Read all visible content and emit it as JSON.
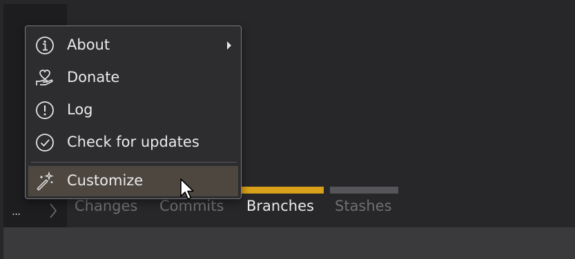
{
  "menu": {
    "items": [
      {
        "label": "About",
        "icon": "info-icon",
        "has_submenu": true
      },
      {
        "label": "Donate",
        "icon": "donate-heart-hand-icon"
      },
      {
        "label": "Log",
        "icon": "alert-circle-icon"
      },
      {
        "label": "Check for updates",
        "icon": "check-circle-icon"
      },
      {
        "label": "Customize",
        "icon": "magic-wand-icon",
        "highlighted": true
      }
    ]
  },
  "tabs": {
    "more_label": "...",
    "items": [
      {
        "label": "Changes",
        "active": false
      },
      {
        "label": "Commits",
        "active": false
      },
      {
        "label": "Branches",
        "active": true
      },
      {
        "label": "Stashes",
        "active": false
      }
    ]
  },
  "colors": {
    "accent": "#d9a019",
    "inactive_indicator": "#55555a",
    "background": "#272729",
    "menu_background": "#2d2d30",
    "highlight": "#4d4740"
  }
}
